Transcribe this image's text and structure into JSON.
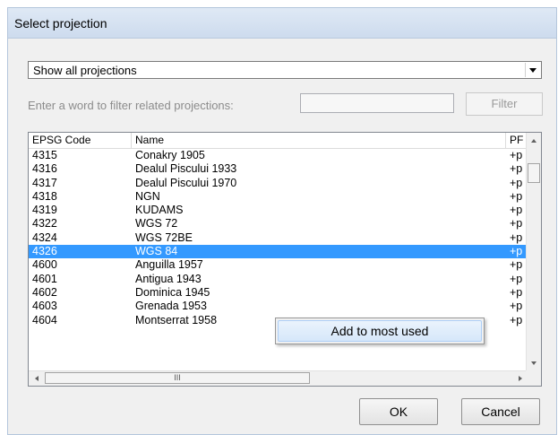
{
  "window": {
    "title": "Select projection"
  },
  "projection_filter": {
    "selected": "Show all projections"
  },
  "filter": {
    "label": "Enter a word to filter related projections:",
    "value": "",
    "button_label": "Filter"
  },
  "table": {
    "columns": [
      "EPSG Code",
      "Name",
      "PF"
    ],
    "rows": [
      {
        "code": "4315",
        "name": "Conakry 1905",
        "proj": "+p"
      },
      {
        "code": "4316",
        "name": "Dealul Piscului 1933",
        "proj": "+p"
      },
      {
        "code": "4317",
        "name": "Dealul Piscului 1970",
        "proj": "+p"
      },
      {
        "code": "4318",
        "name": "NGN",
        "proj": "+p"
      },
      {
        "code": "4319",
        "name": "KUDAMS",
        "proj": "+p"
      },
      {
        "code": "4322",
        "name": "WGS 72",
        "proj": "+p"
      },
      {
        "code": "4324",
        "name": "WGS 72BE",
        "proj": "+p"
      },
      {
        "code": "4326",
        "name": "WGS 84",
        "proj": "+p",
        "selected": true
      },
      {
        "code": "4600",
        "name": "Anguilla 1957",
        "proj": "+p"
      },
      {
        "code": "4601",
        "name": "Antigua 1943",
        "proj": "+p"
      },
      {
        "code": "4602",
        "name": "Dominica 1945",
        "proj": "+p"
      },
      {
        "code": "4603",
        "name": "Grenada 1953",
        "proj": "+p"
      },
      {
        "code": "4604",
        "name": "Montserrat 1958",
        "proj": "+p"
      }
    ],
    "hscroll_grip": "III"
  },
  "context_menu": {
    "items": [
      "Add to most used"
    ]
  },
  "buttons": {
    "ok": "OK",
    "cancel": "Cancel"
  },
  "colors": {
    "selection": "#3399ff",
    "titlebar": "#dfe9f5",
    "menu_hover": "#d6e7fa"
  }
}
